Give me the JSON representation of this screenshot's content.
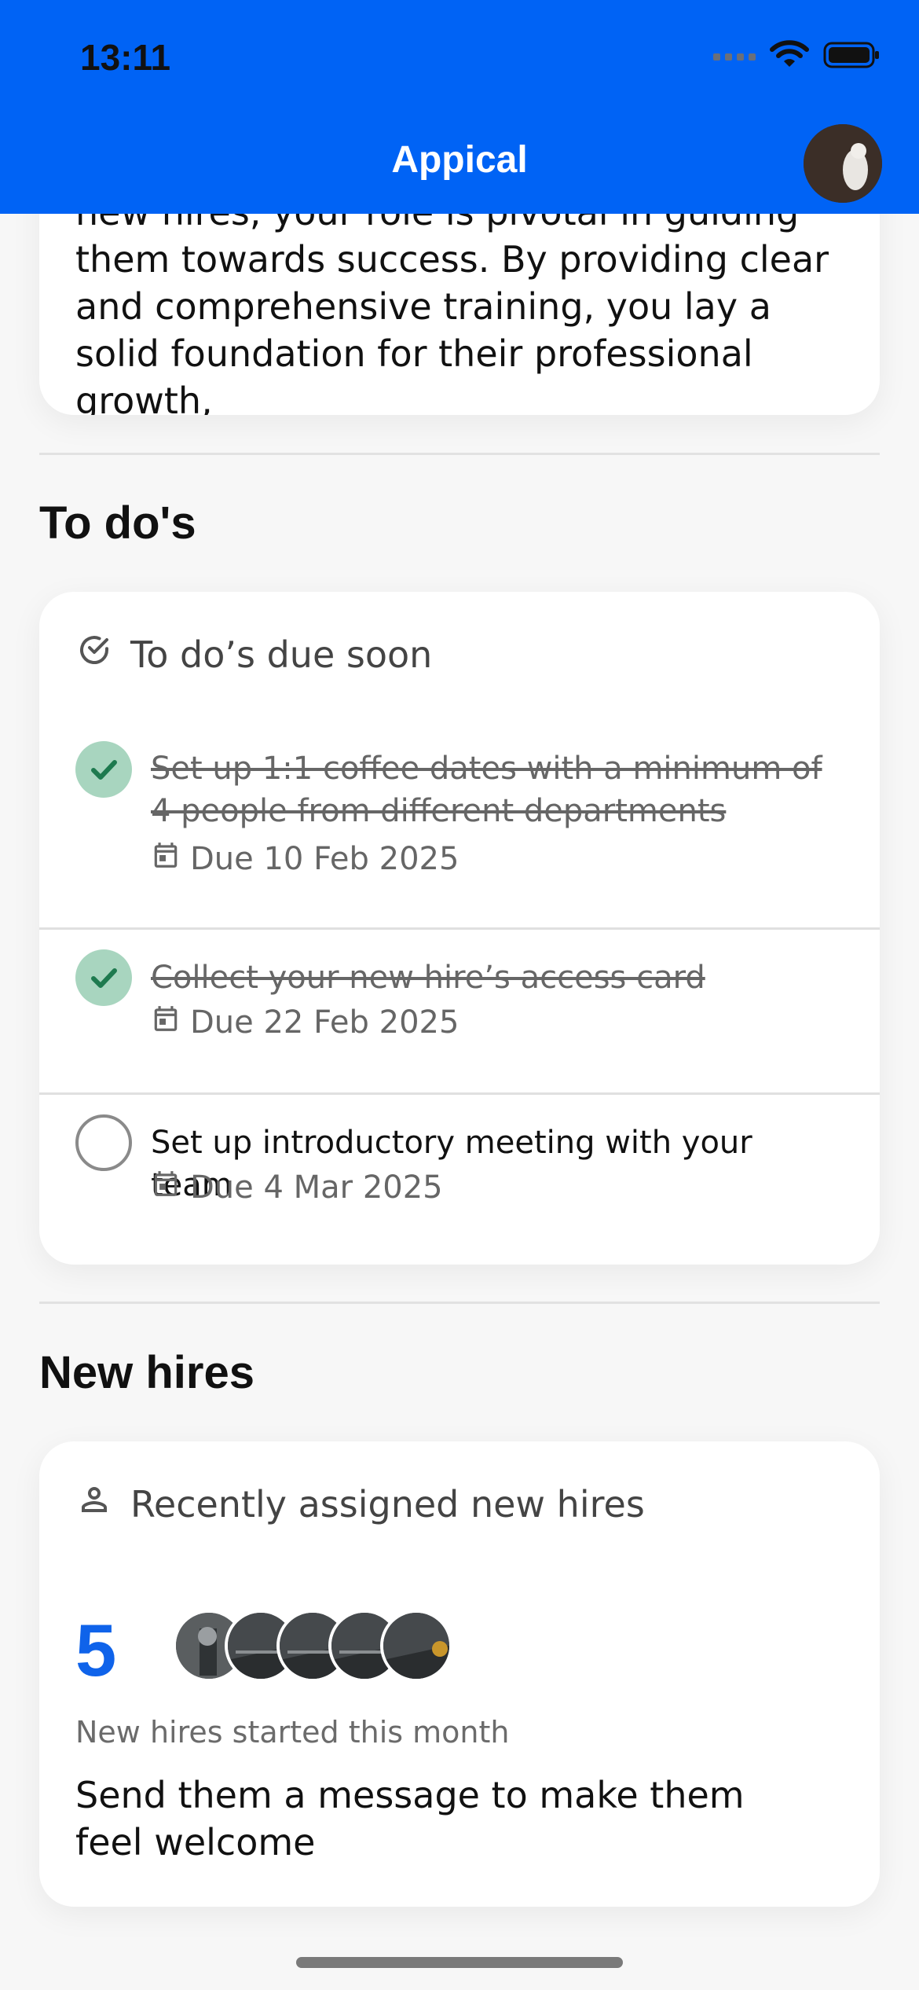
{
  "status_bar": {
    "time": "13:11"
  },
  "header": {
    "title": "Appical"
  },
  "intro": {
    "text": "new hires, your role is pivotal in guiding them towards success. By providing clear and comprehensive training, you lay a solid foundation for their professional growth,"
  },
  "todos": {
    "section_title": "To do's",
    "card_title": "To do’s due soon",
    "items": [
      {
        "text": "Set up 1:1 coffee dates with a minimum of 4 people from different departments",
        "due": "Due 10 Feb 2025",
        "completed": true
      },
      {
        "text": "Collect your new hire’s access card",
        "due": "Due 22 Feb 2025",
        "completed": true
      },
      {
        "text": "Set up introductory meeting with your team",
        "due": "Due 4 Mar 2025",
        "completed": false
      }
    ],
    "completed_color": "#a8d5bf",
    "check_color": "#1e7a4f"
  },
  "new_hires": {
    "section_title": "New hires",
    "card_title": "Recently assigned new hires",
    "count": "5",
    "caption": "New hires started this month",
    "message": "Send them a message to make them feel welcome",
    "accent": "#0f63ea"
  },
  "theme": {
    "header_bg": "#0063f5"
  }
}
